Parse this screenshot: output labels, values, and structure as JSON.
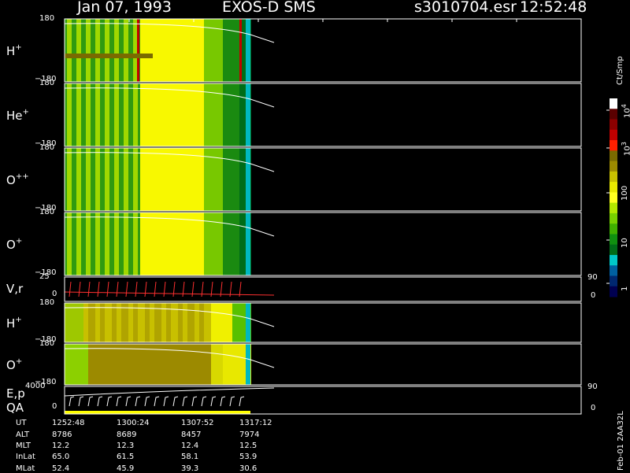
{
  "header": {
    "date": "Jan 07, 1993",
    "instrument": "EXOS-D SMS",
    "file": "s3010704.esr",
    "time": "12:52:48"
  },
  "chart_data": {
    "type": "heatmap",
    "title": "Jan 07, 1993   EXOS-D SMS",
    "panels": [
      {
        "label": "H",
        "charge": "+",
        "ymax": "180",
        "ymin": "−180"
      },
      {
        "label": "He",
        "charge": "+",
        "ymax": "180",
        "ymin": "−180"
      },
      {
        "label": "O",
        "charge": "++",
        "ymax": "180",
        "ymin": "−180"
      },
      {
        "label": "O",
        "charge": "+",
        "ymax": "180",
        "ymin": "−180"
      },
      {
        "label": "V,r",
        "charge": "",
        "ymax": "25",
        "ymin": "0",
        "right_max": "90",
        "right_min": "0"
      },
      {
        "label": "H",
        "charge": "+",
        "ymax": "180",
        "ymin": "−180"
      },
      {
        "label": "O",
        "charge": "+",
        "ymax": "180",
        "ymin": "−180"
      },
      {
        "label": "E,p",
        "label2": "QA",
        "charge": "",
        "ymax": "4000",
        "ymin": "0",
        "right_max": "90",
        "right_min": "0"
      }
    ],
    "colorbar": {
      "unit": "Ct/Smp",
      "ticks": [
        {
          "base": "10",
          "exp": "4"
        },
        {
          "base": "10",
          "exp": "3"
        },
        {
          "base": "100",
          "exp": ""
        },
        {
          "base": "10",
          "exp": ""
        },
        {
          "base": "1",
          "exp": ""
        }
      ],
      "colors": [
        "#ffffff",
        "#5a0000",
        "#8c0000",
        "#c00000",
        "#ff2000",
        "#7a6a00",
        "#9c8a00",
        "#c8c000",
        "#e8e800",
        "#ffff20",
        "#b4e800",
        "#78d000",
        "#40b000",
        "#109010",
        "#006c18",
        "#00c8c8",
        "#0060a0",
        "#002870",
        "#000050"
      ]
    },
    "time_axis": {
      "rows": [
        "UT",
        "ALT",
        "MLT",
        "InLat",
        "MLat"
      ],
      "columns": [
        [
          "1252:48",
          "8786",
          "12.2",
          "65.0",
          "52.4"
        ],
        [
          "1300:24",
          "8689",
          "12.3",
          "61.5",
          "45.9"
        ],
        [
          "1307:52",
          "8457",
          "12.4",
          "58.1",
          "39.3"
        ],
        [
          "1317:12",
          "7974",
          "12.5",
          "53.9",
          "30.6"
        ]
      ]
    },
    "footer": "Feb-01 2AA32L"
  }
}
